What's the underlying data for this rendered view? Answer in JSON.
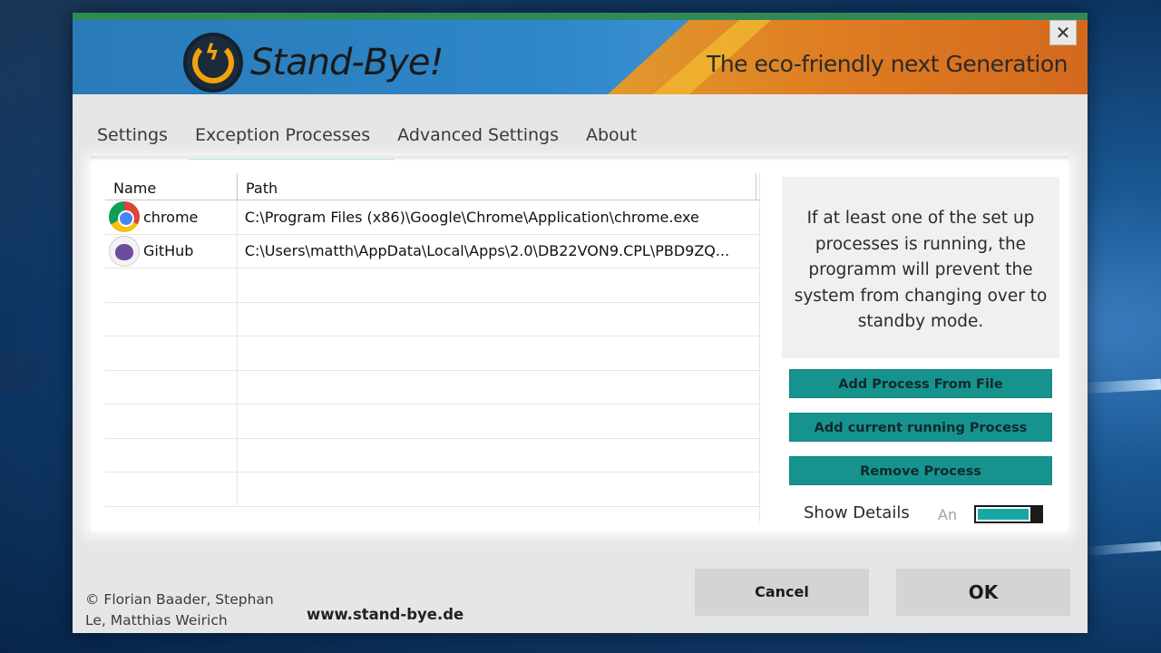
{
  "app": {
    "title": "Stand-Bye!",
    "tagline": "The eco-friendly next Generation",
    "close_glyph": "✕",
    "logo_glyph": "ϟ"
  },
  "tabs": [
    {
      "label": "Settings",
      "active": false
    },
    {
      "label": "Exception Processes",
      "active": true
    },
    {
      "label": "Advanced Settings",
      "active": false
    },
    {
      "label": "About",
      "active": false
    }
  ],
  "table": {
    "columns": [
      "Name",
      "Path"
    ],
    "rows": [
      {
        "name": "chrome",
        "icon": "chrome-icon",
        "path": "C:\\Program Files (x86)\\Google\\Chrome\\Application\\chrome.exe"
      },
      {
        "name": "GitHub",
        "icon": "github-icon",
        "path": "C:\\Users\\matth\\AppData\\Local\\Apps\\2.0\\DB22VON9.CPL\\PBD9ZQ..."
      }
    ]
  },
  "info": {
    "text": "If at least one of the set up processes is running, the programm will prevent the system from changing over to standby mode."
  },
  "actions": {
    "add_from_file": "Add Process From File",
    "add_running": "Add current running Process",
    "remove": "Remove Process"
  },
  "details_toggle": {
    "label": "Show Details",
    "state_text": "An",
    "on": true
  },
  "footer": {
    "copyright": "© Florian Baader, Stephan Le, Matthias Weirich",
    "website": "www.stand-bye.de",
    "cancel_label": "Cancel",
    "ok_label": "OK"
  },
  "colors": {
    "accent": "#17938f",
    "banner_blue": "#2e86c7",
    "banner_orange": "#df7d22",
    "logo_yellow": "#f1a20d"
  }
}
